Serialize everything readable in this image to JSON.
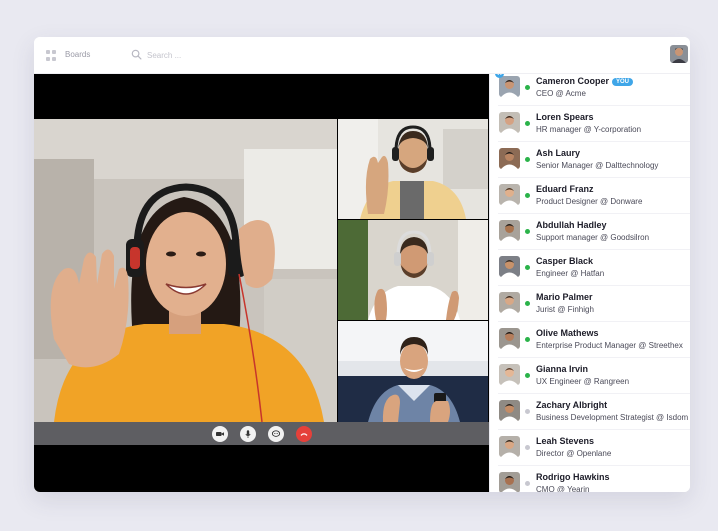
{
  "header": {
    "boards_label": "Boards",
    "search_placeholder": "Search ..."
  },
  "controls": {
    "icons": [
      "video-camera-icon",
      "microphone-icon",
      "chat-icon",
      "end-call-icon"
    ]
  },
  "colors": {
    "online": "#2bb34a",
    "offline": "#c8c8d0",
    "you_badge": "#3fa6e8",
    "end_call": "#e5403a"
  },
  "participants": [
    {
      "name": "Cameron Cooper",
      "role": "CEO @ Acme",
      "badge": "YOU",
      "status": "online"
    },
    {
      "name": "Loren Spears",
      "role": "HR manager @ Y-corporation",
      "status": "online"
    },
    {
      "name": "Ash Laury",
      "role": "Senior Manager @ Dalttechnology",
      "status": "online"
    },
    {
      "name": "Eduard Franz",
      "role": "Product Designer @ Donware",
      "status": "online"
    },
    {
      "name": "Abdullah Hadley",
      "role": "Support manager @ Goodsilron",
      "status": "online"
    },
    {
      "name": "Casper Black",
      "role": "Engineer @ Hatfan",
      "status": "online"
    },
    {
      "name": "Mario Palmer",
      "role": "Jurist @ Finhigh",
      "status": "online"
    },
    {
      "name": "Olive Mathews",
      "role": "Enterprise Product Manager @ Streethex",
      "status": "online"
    },
    {
      "name": "Gianna Irvin",
      "role": "UX Engineer @ Rangreen",
      "status": "online"
    },
    {
      "name": "Zachary Albright",
      "role": "Business Development Strategist @ Isdom",
      "status": "offline"
    },
    {
      "name": "Leah Stevens",
      "role": "Director @ Openlane",
      "status": "offline"
    },
    {
      "name": "Rodrigo Hawkins",
      "role": "CMO @ Yearin",
      "status": "offline"
    }
  ]
}
